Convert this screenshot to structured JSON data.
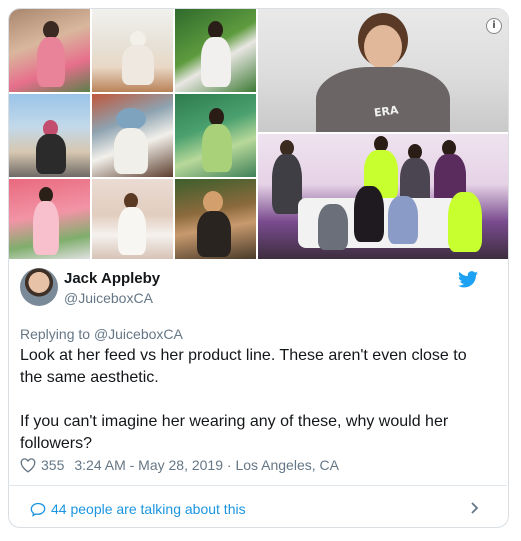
{
  "media": {
    "overlay_text": "ERA",
    "tiles": [
      {
        "name": "feed-photo-1"
      },
      {
        "name": "feed-photo-2"
      },
      {
        "name": "feed-photo-3"
      },
      {
        "name": "feed-photo-4"
      },
      {
        "name": "feed-photo-5"
      },
      {
        "name": "feed-photo-6"
      },
      {
        "name": "feed-photo-7"
      },
      {
        "name": "feed-photo-8"
      },
      {
        "name": "feed-photo-9"
      },
      {
        "name": "product-photo-model"
      },
      {
        "name": "product-photo-group"
      }
    ],
    "info_icon": "i"
  },
  "tweet": {
    "author_name": "Jack Appleby",
    "author_handle": "@JuiceboxCA",
    "replying_prefix": "Replying to ",
    "replying_to": "@JuiceboxCA",
    "text": "Look at her feed vs her product line. These aren't even close to the same aesthetic.\n\nIf you can't imagine her wearing any of these, why would her followers?",
    "likes": "355",
    "timestamp": "3:24 AM - May 28, 2019",
    "separator": " · ",
    "location": "Los Angeles, CA",
    "talking": "44 people are talking about this"
  },
  "icons": {
    "brand": "twitter-bird-icon",
    "like": "heart-icon",
    "talk": "speech-bubble-icon",
    "chevron": "chevron-right-icon",
    "info": "info-icon"
  },
  "colors": {
    "brand": "#1da1f2",
    "link": "#1b95e0",
    "muted": "#657786",
    "text": "#14171a",
    "border": "#d9dee3"
  }
}
